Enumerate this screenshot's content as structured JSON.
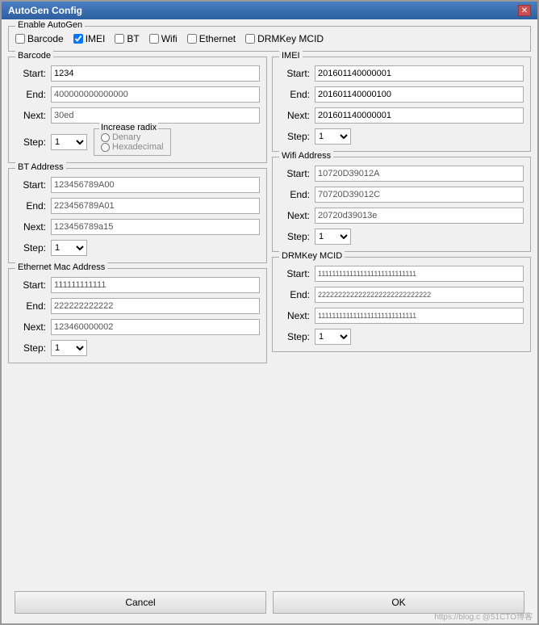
{
  "window": {
    "title": "AutoGen Config",
    "close_button": "✕"
  },
  "enable_autogen": {
    "title": "Enable AutoGen",
    "checkboxes": [
      {
        "id": "cb-barcode",
        "label": "Barcode",
        "checked": false
      },
      {
        "id": "cb-imei",
        "label": "IMEI",
        "checked": true
      },
      {
        "id": "cb-bt",
        "label": "BT",
        "checked": false
      },
      {
        "id": "cb-wifi",
        "label": "Wifi",
        "checked": false
      },
      {
        "id": "cb-ethernet",
        "label": "Ethernet",
        "checked": false
      },
      {
        "id": "cb-drmkey",
        "label": "DRMKey MCID",
        "checked": false
      }
    ]
  },
  "barcode": {
    "title": "Barcode",
    "start_label": "Start:",
    "start_value": "1234",
    "end_label": "End:",
    "end_value": "400000000000000",
    "next_label": "Next:",
    "next_value": "30ed",
    "step_label": "Step:",
    "step_value": "1",
    "increase_radix_title": "Increase radix",
    "denary_label": "Denary",
    "hexadecimal_label": "Hexadecimal"
  },
  "imei": {
    "title": "IMEI",
    "start_label": "Start:",
    "start_value": "201601140000001",
    "end_label": "End:",
    "end_value": "201601140000100",
    "next_label": "Next:",
    "next_value": "201601140000001",
    "step_label": "Step:",
    "step_value": "1"
  },
  "bt_address": {
    "title": "BT Address",
    "start_label": "Start:",
    "start_value": "123456789A00",
    "end_label": "End:",
    "end_value": "223456789A01",
    "next_label": "Next:",
    "next_value": "123456789a15",
    "step_label": "Step:",
    "step_value": "1"
  },
  "wifi_address": {
    "title": "Wifi Address",
    "start_label": "Start:",
    "start_value": "10720D39012A",
    "end_label": "End:",
    "end_value": "70720D39012C",
    "next_label": "Next:",
    "next_value": "20720d39013e",
    "step_label": "Step:",
    "step_value": "1"
  },
  "ethernet_mac": {
    "title": "Ethernet Mac Address",
    "start_label": "Start:",
    "start_value": "111111111111",
    "end_label": "End:",
    "end_value": "222222222222",
    "next_label": "Next:",
    "next_value": "123460000002",
    "step_label": "Step:",
    "step_value": "1"
  },
  "drmkey_mcid": {
    "title": "DRMKey MCID",
    "start_label": "Start:",
    "start_value": "1111111111111111111111111111",
    "end_label": "End:",
    "end_value": "2222222222222222222222222222",
    "next_label": "Next:",
    "next_value": "1111111111111111111111111111",
    "step_label": "Step:",
    "step_value": "1"
  },
  "buttons": {
    "cancel_label": "Cancel",
    "ok_label": "OK"
  },
  "watermark": "https://blog.c @51CTO博客"
}
